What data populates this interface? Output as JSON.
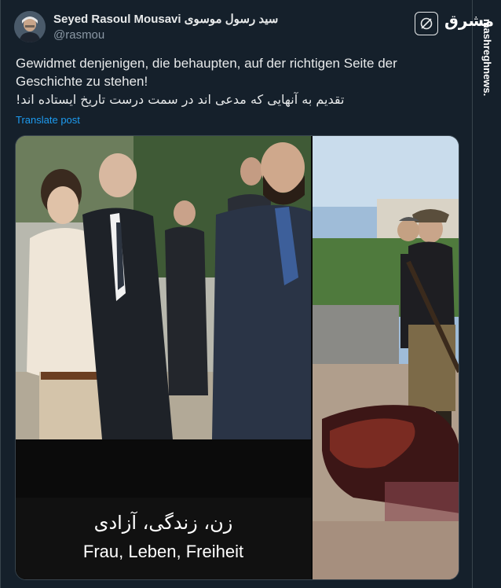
{
  "author": {
    "display_name": "Seyed Rasoul Mousavi سید رسول موسوی",
    "handle": "@rasmou"
  },
  "header": {
    "grok_icon": "grok-slash-icon",
    "logo_text": "مشرق",
    "vertical_url": "mashreghnews.ir"
  },
  "tweet": {
    "lines": [
      "Gewidmet denjenigen, die behaupten, auf der richtigen Seite der",
      "Geschichte zu stehen!",
      "تقدیم به آنهایی که مدعی اند در سمت درست تاریخ ایستاده اند!"
    ],
    "translate_label": "Translate post"
  },
  "media": {
    "caption_farsi": "زن، زندگی، آزادی",
    "caption_german": "Frau, Leben, Freiheit"
  },
  "colors": {
    "background": "#15202b",
    "link": "#1d9bf0",
    "secondary_text": "#8b98a5",
    "border": "#38444d"
  }
}
